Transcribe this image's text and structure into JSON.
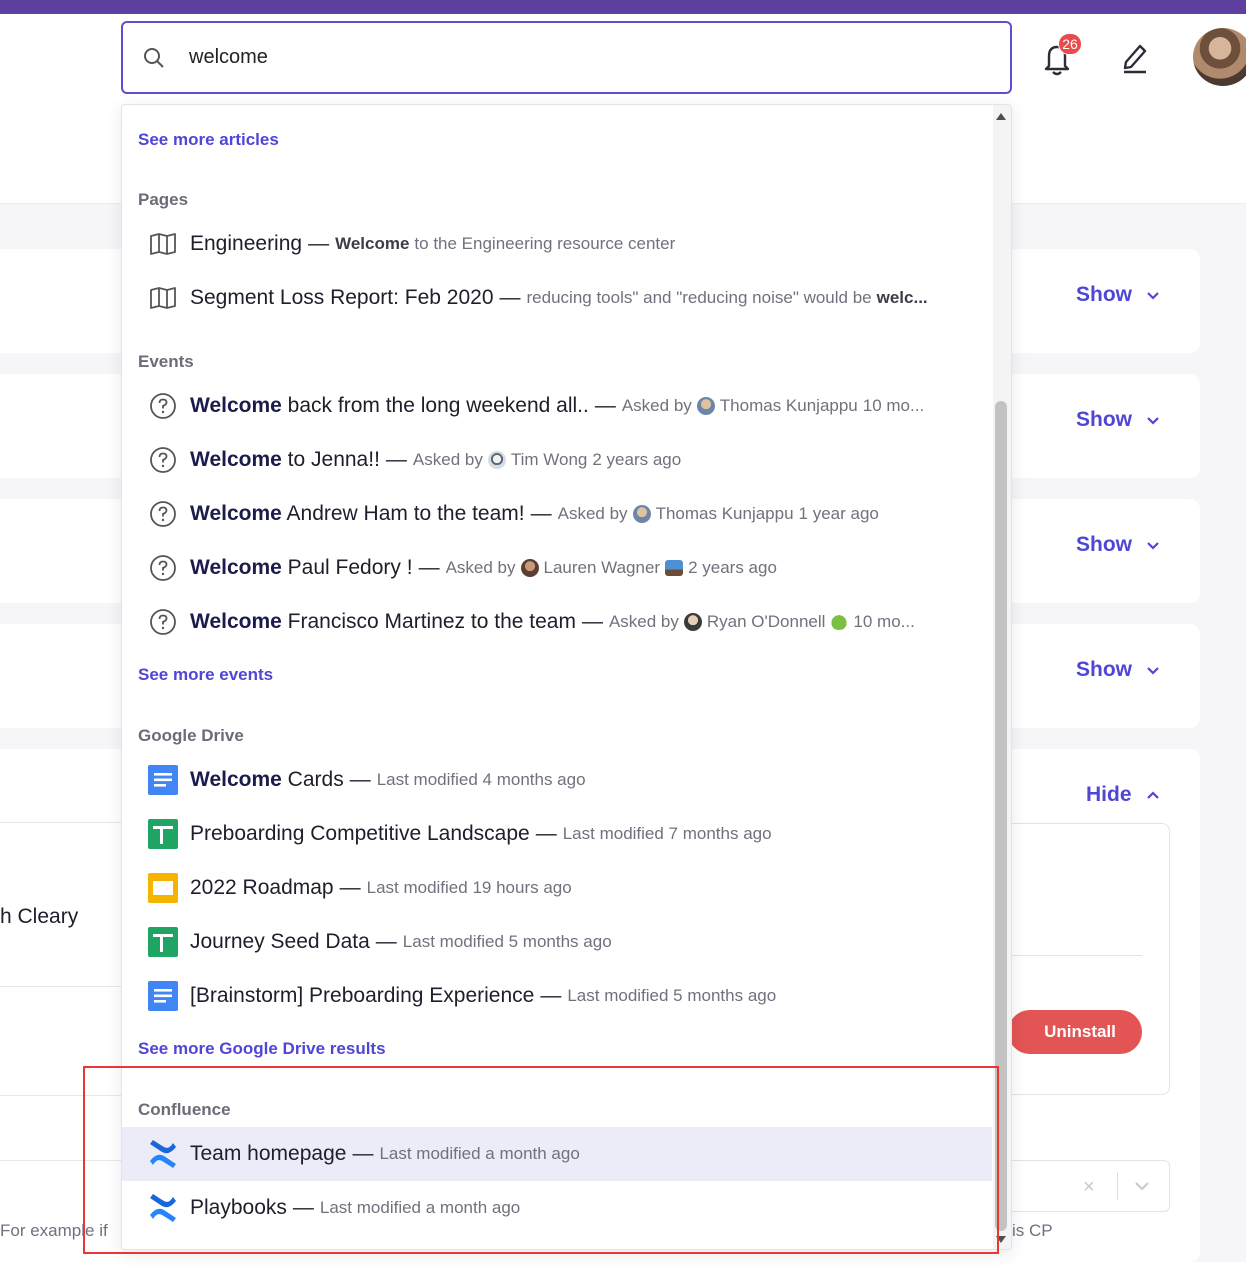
{
  "search": {
    "value": "welcome"
  },
  "header": {
    "notifications_count": "26"
  },
  "dropdown": {
    "see_more_articles": "See more articles",
    "pages": {
      "title": "Pages",
      "items": [
        {
          "title": "Engineering",
          "meta_bold": "Welcome",
          "meta": "to the Engineering resource center"
        },
        {
          "title": "Segment Loss Report: Feb 2020",
          "meta": "reducing tools\" and \"reducing noise\" would be",
          "meta_bold": "welc..."
        }
      ]
    },
    "events": {
      "title": "Events",
      "asked_by": "Asked by",
      "items": [
        {
          "bold": "Welcome",
          "rest": "back from the long weekend all..",
          "person": "Thomas Kunjappu",
          "time": "10 mo..."
        },
        {
          "bold": "Welcome",
          "rest": "to Jenna!!",
          "person": "Tim Wong",
          "time": "2 years ago"
        },
        {
          "bold": "Welcome",
          "rest": "Andrew Ham  to the team!",
          "person": "Thomas Kunjappu",
          "time": "1 year ago"
        },
        {
          "bold": "Welcome",
          "rest": "Paul Fedory !",
          "person": "Lauren Wagner",
          "time": "2 years ago"
        },
        {
          "bold": "Welcome",
          "rest": "Francisco Martinez  to the team",
          "person": "Ryan O'Donnell",
          "time": "10 mo..."
        }
      ],
      "see_more": "See more events"
    },
    "google_drive": {
      "title": "Google Drive",
      "items": [
        {
          "bold": "Welcome",
          "rest": "Cards",
          "meta": "Last modified 4 months ago",
          "icon": "google-docs-icon"
        },
        {
          "bold": "",
          "rest": "Preboarding Competitive Landscape",
          "meta": "Last modified 7 months ago",
          "icon": "google-sheets-icon"
        },
        {
          "bold": "",
          "rest": "2022 Roadmap",
          "meta": "Last modified 19 hours ago",
          "icon": "google-slides-icon"
        },
        {
          "bold": "",
          "rest": "Journey Seed Data",
          "meta": "Last modified 5 months ago",
          "icon": "google-sheets-icon"
        },
        {
          "bold": "",
          "rest": "[Brainstorm] Preboarding Experience",
          "meta": "Last modified 5 months ago",
          "icon": "google-docs-icon"
        }
      ],
      "see_more": "See more Google Drive results"
    },
    "confluence": {
      "title": "Confluence",
      "items": [
        {
          "title": "Team homepage",
          "meta": "Last modified a month ago"
        },
        {
          "title": "Playbooks",
          "meta": "Last modified a month ago"
        }
      ]
    },
    "dash": "—"
  },
  "background": {
    "show_label": "Show",
    "hide_label": "Hide",
    "uninstall_label": "Uninstall",
    "name_fragment": "h Cleary",
    "example_fragment": "For example if",
    "cp_fragment": "is CP",
    "clear_label": "×"
  },
  "colors": {
    "accent": "#4f46d6",
    "brand_bar": "#5d3f9f",
    "danger": "#e35454",
    "highlight_border": "#e53935"
  }
}
